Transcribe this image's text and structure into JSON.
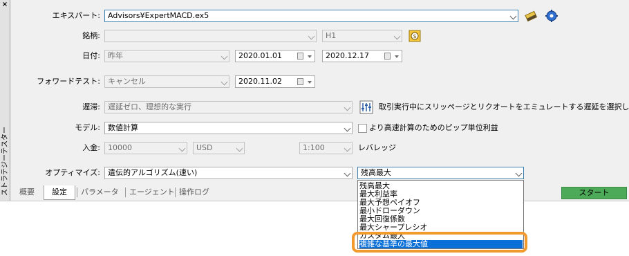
{
  "sidebar": {
    "close_label": "×",
    "title": "ストラテジーテスター"
  },
  "expert": {
    "label": "エキスパート:",
    "value": "Advisors¥ExpertMACD.ex5"
  },
  "symbol": {
    "label": "銘柄:",
    "value": "",
    "period": "H1"
  },
  "date": {
    "label": "日付:",
    "mode": "昨年",
    "from": "2020.01.01",
    "to": "2020.12.17"
  },
  "forward": {
    "label": "フォワードテスト:",
    "mode": "キャンセル",
    "date": "2020.11.02"
  },
  "delay": {
    "label": "遅滞:",
    "value": "遅延ゼロ、理想的な実行",
    "description": "取引実行中にスリッページとリクオートをエミュレートする遅延を選択します"
  },
  "model": {
    "label": "モデル:",
    "value": "数値計算",
    "checkbox_label": "より高速計算のためのピップ単位利益"
  },
  "deposit": {
    "label": "入金:",
    "amount": "10000",
    "currency": "USD",
    "leverage": "1:100",
    "leverage_label": "レバレッジ"
  },
  "optimize": {
    "label": "オプティマイズ:",
    "method": "遺伝的アルゴリズム(速い)",
    "criterion": "残高最大"
  },
  "criterion_options": [
    "残高最大",
    "最大利益率",
    "最大予想ペイオフ",
    "最小ドローダウン",
    "最大回復係数",
    "最大シャープレシオ",
    "カスタム最大",
    "複雑な基準の最大値"
  ],
  "selected_option": "複雑な基準の最大値",
  "tabs": {
    "overview": "概要",
    "settings": "設定",
    "params": "パラメータ",
    "agents": "エージェント",
    "log": "操作ログ"
  },
  "start_label": "スタート",
  "colors": {
    "start": "#4caa58",
    "highlight_ring": "#f29a2e",
    "selection": "#0a6fd7"
  }
}
